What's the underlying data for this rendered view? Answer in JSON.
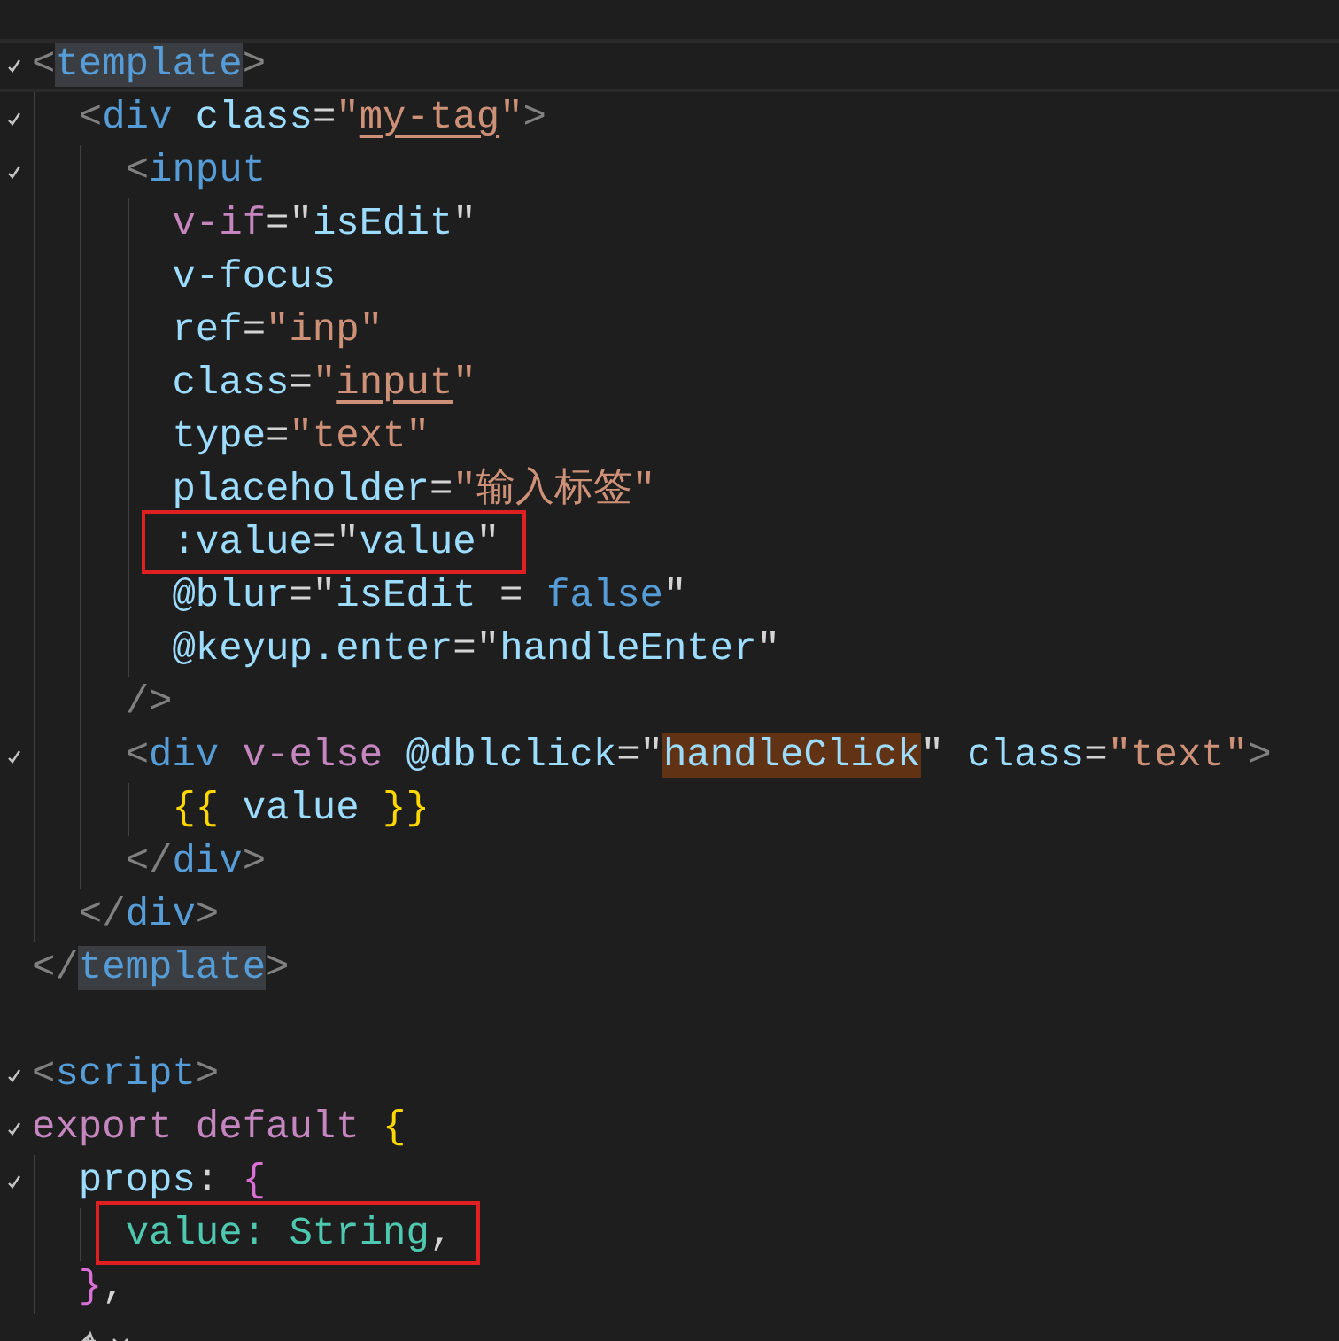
{
  "editor": {
    "lines": [
      {
        "foldable": true,
        "current": true,
        "boxed": false,
        "tokens": [
          {
            "text": "<",
            "kind": "punct"
          },
          {
            "text": "template",
            "kind": "tag",
            "matched": true
          },
          {
            "text": ">",
            "kind": "punct"
          }
        ]
      },
      {
        "foldable": true,
        "current": false,
        "boxed": false,
        "tokens": [
          {
            "text": "  <",
            "kind": "punct"
          },
          {
            "text": "div",
            "kind": "tag"
          },
          {
            "text": " class",
            "kind": "attr"
          },
          {
            "text": "=",
            "kind": "op"
          },
          {
            "text": "\"",
            "kind": "str"
          },
          {
            "text": "my-tag",
            "kind": "str",
            "underlined": true
          },
          {
            "text": "\"",
            "kind": "str"
          },
          {
            "text": ">",
            "kind": "punct"
          }
        ]
      },
      {
        "foldable": true,
        "current": false,
        "boxed": false,
        "tokens": [
          {
            "text": "    <",
            "kind": "punct"
          },
          {
            "text": "input",
            "kind": "tag"
          }
        ]
      },
      {
        "foldable": false,
        "current": false,
        "boxed": false,
        "tokens": [
          {
            "text": "      v-if",
            "kind": "dir"
          },
          {
            "text": "=\"",
            "kind": "op"
          },
          {
            "text": "isEdit",
            "kind": "attr"
          },
          {
            "text": "\"",
            "kind": "op"
          }
        ]
      },
      {
        "foldable": false,
        "current": false,
        "boxed": false,
        "tokens": [
          {
            "text": "      v-focus",
            "kind": "attr"
          }
        ]
      },
      {
        "foldable": false,
        "current": false,
        "boxed": false,
        "tokens": [
          {
            "text": "      ref",
            "kind": "attr"
          },
          {
            "text": "=",
            "kind": "op"
          },
          {
            "text": "\"inp\"",
            "kind": "str"
          }
        ]
      },
      {
        "foldable": false,
        "current": false,
        "boxed": false,
        "tokens": [
          {
            "text": "      class",
            "kind": "attr"
          },
          {
            "text": "=",
            "kind": "op"
          },
          {
            "text": "\"",
            "kind": "str"
          },
          {
            "text": "input",
            "kind": "str",
            "underlined": true
          },
          {
            "text": "\"",
            "kind": "str"
          }
        ]
      },
      {
        "foldable": false,
        "current": false,
        "boxed": false,
        "tokens": [
          {
            "text": "      type",
            "kind": "attr"
          },
          {
            "text": "=",
            "kind": "op"
          },
          {
            "text": "\"text\"",
            "kind": "str"
          }
        ]
      },
      {
        "foldable": false,
        "current": false,
        "boxed": false,
        "tokens": [
          {
            "text": "      placeholder",
            "kind": "attr"
          },
          {
            "text": "=",
            "kind": "op"
          },
          {
            "text": "\"输入标签\"",
            "kind": "str"
          }
        ]
      },
      {
        "foldable": false,
        "current": false,
        "boxed": true,
        "tokens": [
          {
            "text": "      :value",
            "kind": "attr"
          },
          {
            "text": "=\"",
            "kind": "op"
          },
          {
            "text": "value",
            "kind": "attr"
          },
          {
            "text": "\"",
            "kind": "op"
          }
        ]
      },
      {
        "foldable": false,
        "current": false,
        "boxed": false,
        "tokens": [
          {
            "text": "      @blur",
            "kind": "attr"
          },
          {
            "text": "=\"",
            "kind": "op"
          },
          {
            "text": "isEdit",
            "kind": "attr"
          },
          {
            "text": " = ",
            "kind": "op"
          },
          {
            "text": "false",
            "kind": "bool"
          },
          {
            "text": "\"",
            "kind": "op"
          }
        ]
      },
      {
        "foldable": false,
        "current": false,
        "boxed": false,
        "tokens": [
          {
            "text": "      @keyup.enter",
            "kind": "attr"
          },
          {
            "text": "=\"",
            "kind": "op"
          },
          {
            "text": "handleEnter",
            "kind": "attr"
          },
          {
            "text": "\"",
            "kind": "op"
          }
        ]
      },
      {
        "foldable": false,
        "current": false,
        "boxed": false,
        "tokens": [
          {
            "text": "    />",
            "kind": "punct"
          }
        ]
      },
      {
        "foldable": true,
        "current": false,
        "boxed": false,
        "tokens": [
          {
            "text": "    <",
            "kind": "punct"
          },
          {
            "text": "div",
            "kind": "tag"
          },
          {
            "text": " v-else",
            "kind": "dir"
          },
          {
            "text": " @dblclick",
            "kind": "attr"
          },
          {
            "text": "=\"",
            "kind": "op"
          },
          {
            "text": "handleClick",
            "kind": "attr",
            "found": true
          },
          {
            "text": "\"",
            "kind": "op"
          },
          {
            "text": " class",
            "kind": "attr"
          },
          {
            "text": "=",
            "kind": "op"
          },
          {
            "text": "\"text\"",
            "kind": "str"
          },
          {
            "text": ">",
            "kind": "punct"
          }
        ]
      },
      {
        "foldable": false,
        "current": false,
        "boxed": false,
        "tokens": [
          {
            "text": "      {{",
            "kind": "brace1"
          },
          {
            "text": " value ",
            "kind": "attr"
          },
          {
            "text": "}}",
            "kind": "brace1"
          }
        ]
      },
      {
        "foldable": false,
        "current": false,
        "boxed": false,
        "tokens": [
          {
            "text": "    </",
            "kind": "punct"
          },
          {
            "text": "div",
            "kind": "tag"
          },
          {
            "text": ">",
            "kind": "punct"
          }
        ]
      },
      {
        "foldable": false,
        "current": false,
        "boxed": false,
        "tokens": [
          {
            "text": "  </",
            "kind": "punct"
          },
          {
            "text": "div",
            "kind": "tag"
          },
          {
            "text": ">",
            "kind": "punct"
          }
        ]
      },
      {
        "foldable": false,
        "current": false,
        "boxed": false,
        "tokens": [
          {
            "text": "</",
            "kind": "punct"
          },
          {
            "text": "template",
            "kind": "tag",
            "matched": true
          },
          {
            "text": ">",
            "kind": "punct"
          }
        ]
      },
      {
        "foldable": false,
        "current": false,
        "boxed": false
      },
      {
        "foldable": true,
        "current": false,
        "boxed": false,
        "tokens": [
          {
            "text": "<",
            "kind": "punct"
          },
          {
            "text": "script",
            "kind": "tag"
          },
          {
            "text": ">",
            "kind": "punct"
          }
        ]
      },
      {
        "foldable": true,
        "current": false,
        "boxed": false,
        "tokens": [
          {
            "text": "export default ",
            "kind": "kw"
          },
          {
            "text": "{",
            "kind": "brace1"
          }
        ]
      },
      {
        "foldable": true,
        "current": false,
        "boxed": false,
        "tokens": [
          {
            "text": "  props",
            "kind": "attr"
          },
          {
            "text": ": ",
            "kind": "op"
          },
          {
            "text": "{",
            "kind": "brace2"
          }
        ]
      },
      {
        "foldable": false,
        "current": false,
        "boxed": true,
        "tokens": [
          {
            "text": "    value: String",
            "kind": "type"
          },
          {
            "text": ",",
            "kind": "op"
          }
        ]
      },
      {
        "foldable": false,
        "current": false,
        "boxed": false,
        "tokens": [
          {
            "text": "  }",
            "kind": "brace2"
          },
          {
            "text": ",",
            "kind": "op"
          }
        ]
      }
    ],
    "code_action": true
  }
}
